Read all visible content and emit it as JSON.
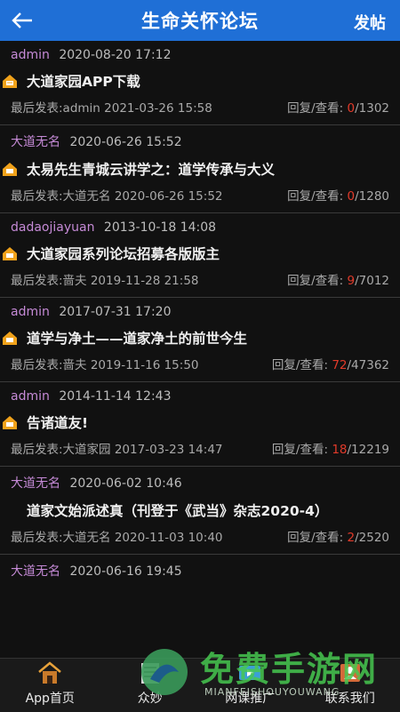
{
  "header": {
    "title": "生命关怀论坛",
    "post_label": "发帖"
  },
  "posts": [
    {
      "author": "admin",
      "date": "2020-08-20 17:12",
      "hot": true,
      "title": "大道家园APP下载",
      "last_label": "最后发表:admin 2021-03-26 15:58",
      "stats_label": "回复/查看: ",
      "replies": "0",
      "views": "/1302"
    },
    {
      "author": "大道无名",
      "date": "2020-06-26 15:52",
      "hot": true,
      "title": "太易先生青城云讲学之：道学传承与大义",
      "last_label": "最后发表:大道无名 2020-06-26 15:52",
      "stats_label": "回复/查看: ",
      "replies": "0",
      "views": "/1280"
    },
    {
      "author": "dadaojiayuan",
      "date": "2013-10-18 14:08",
      "hot": true,
      "title": "大道家园系列论坛招募各版版主",
      "last_label": "最后发表:啬夫 2019-11-28 21:58",
      "stats_label": "回复/查看: ",
      "replies": "9",
      "views": "/7012"
    },
    {
      "author": "admin",
      "date": "2017-07-31 17:20",
      "hot": true,
      "title": "道学与净土——道家净土的前世今生",
      "last_label": "最后发表:啬夫 2019-11-16 15:50",
      "stats_label": "回复/查看: ",
      "replies": "72",
      "views": "/47362"
    },
    {
      "author": "admin",
      "date": "2014-11-14 12:43",
      "hot": true,
      "title": "告诸道友!",
      "last_label": "最后发表:大道家园 2017-03-23 14:47",
      "stats_label": "回复/查看: ",
      "replies": "18",
      "views": "/12219"
    },
    {
      "author": "大道无名",
      "date": "2020-06-02 10:46",
      "hot": false,
      "title": "道家文始派述真（刊登于《武当》杂志2020-4）",
      "last_label": "最后发表:大道无名 2020-11-03 10:40",
      "stats_label": "回复/查看: ",
      "replies": "2",
      "views": "/2520"
    },
    {
      "author": "大道无名",
      "date": "2020-06-16 19:45",
      "hot": false,
      "title": "",
      "last_label": "",
      "stats_label": "",
      "replies": "",
      "views": ""
    }
  ],
  "tabs": [
    {
      "label": "App首页",
      "icon": "home-icon"
    },
    {
      "label": "众妙",
      "icon": "book-icon"
    },
    {
      "label": "网课推广",
      "icon": "video-icon"
    },
    {
      "label": "联系我们",
      "icon": "contact-icon"
    }
  ],
  "watermark": {
    "text": "免费手游网",
    "subtext": "MIANFEISHOUYOUWANG"
  },
  "colors": {
    "header": "#1f6fd6",
    "author": "#c58ad6",
    "replies": "#e23a2a",
    "hot_icon": "#f0a21b"
  }
}
